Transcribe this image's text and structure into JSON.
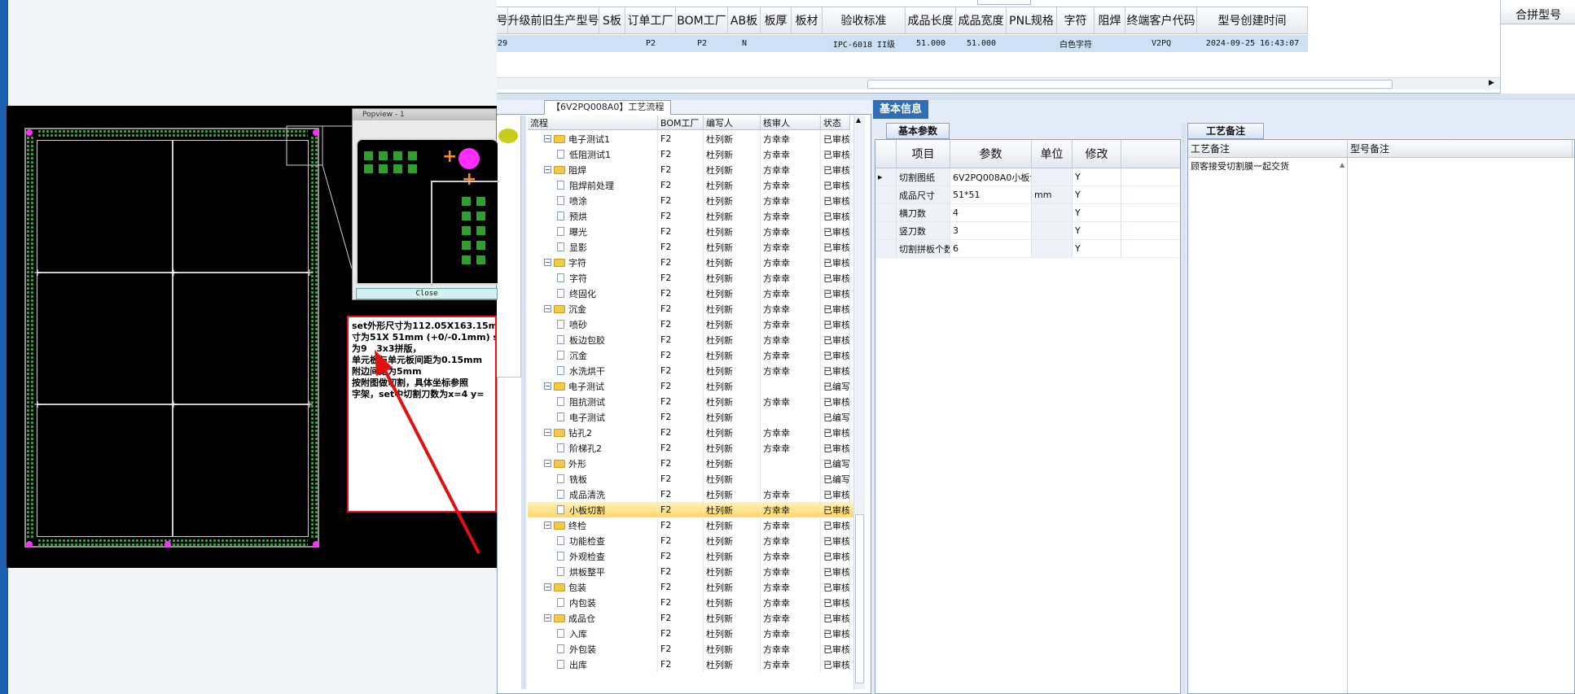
{
  "top_grid": {
    "columns": [
      "号",
      "升级前旧生产型号",
      "S板",
      "订单工厂",
      "BOM工厂",
      "AB板",
      "板厚",
      "板材",
      "验收标准",
      "成品长度",
      "成品宽度",
      "PNL规格",
      "字符",
      "阻焊",
      "终端客户代码",
      "型号创建时间"
    ],
    "row": [
      "29",
      "",
      "",
      "P2",
      "P2",
      "N",
      "",
      "",
      "IPC-6018 II级",
      "51.000",
      "51.000",
      "",
      "白色字符",
      "",
      "V2PQ",
      "2024-09-25 16:43:07"
    ],
    "right_column": "合拼型号"
  },
  "cad": {
    "popview_title": "Popview - 1",
    "popview_close": "Close",
    "note_text": "set外形尺寸为112.05X163.15m\n寸为51X 51mm (+0/-0.1mm) set\n为9   3x3拼版，\n单元板与单元板间距为0.15mm\n附边间距为5mm\n按附图做切割，具体坐标参照\n字架，set中切割刀数为x=4 y="
  },
  "flow": {
    "tab_title": "【6V2PQ008A0】工艺流程",
    "headers": [
      "流程",
      "BOM工厂",
      "编写人",
      "核审人",
      "状态"
    ],
    "rows": [
      {
        "level": 1,
        "name": "电子测试1",
        "bom": "F2",
        "writer": "杜列新",
        "reviewer": "方幸幸",
        "status": "已审核",
        "folder": true
      },
      {
        "level": 2,
        "name": "低阻测试1",
        "bom": "F2",
        "writer": "杜列新",
        "reviewer": "方幸幸",
        "status": "已审核",
        "folder": false
      },
      {
        "level": 1,
        "name": "阻焊",
        "bom": "F2",
        "writer": "杜列新",
        "reviewer": "方幸幸",
        "status": "已审核",
        "folder": true
      },
      {
        "level": 2,
        "name": "阻焊前处理",
        "bom": "F2",
        "writer": "杜列新",
        "reviewer": "方幸幸",
        "status": "已审核",
        "folder": false
      },
      {
        "level": 2,
        "name": "喷涂",
        "bom": "F2",
        "writer": "杜列新",
        "reviewer": "方幸幸",
        "status": "已审核",
        "folder": false
      },
      {
        "level": 2,
        "name": "预烘",
        "bom": "F2",
        "writer": "杜列新",
        "reviewer": "方幸幸",
        "status": "已审核",
        "folder": false
      },
      {
        "level": 2,
        "name": "曝光",
        "bom": "F2",
        "writer": "杜列新",
        "reviewer": "方幸幸",
        "status": "已审核",
        "folder": false
      },
      {
        "level": 2,
        "name": "显影",
        "bom": "F2",
        "writer": "杜列新",
        "reviewer": "方幸幸",
        "status": "已审核",
        "folder": false
      },
      {
        "level": 1,
        "name": "字符",
        "bom": "F2",
        "writer": "杜列新",
        "reviewer": "方幸幸",
        "status": "已审核",
        "folder": true
      },
      {
        "level": 2,
        "name": "字符",
        "bom": "F2",
        "writer": "杜列新",
        "reviewer": "方幸幸",
        "status": "已审核",
        "folder": false
      },
      {
        "level": 2,
        "name": "终固化",
        "bom": "F2",
        "writer": "杜列新",
        "reviewer": "方幸幸",
        "status": "已审核",
        "folder": false
      },
      {
        "level": 1,
        "name": "沉金",
        "bom": "F2",
        "writer": "杜列新",
        "reviewer": "方幸幸",
        "status": "已审核",
        "folder": true
      },
      {
        "level": 2,
        "name": "喷砂",
        "bom": "F2",
        "writer": "杜列新",
        "reviewer": "方幸幸",
        "status": "已审核",
        "folder": false
      },
      {
        "level": 2,
        "name": "板边包胶",
        "bom": "F2",
        "writer": "杜列新",
        "reviewer": "方幸幸",
        "status": "已审核",
        "folder": false
      },
      {
        "level": 2,
        "name": "沉金",
        "bom": "F2",
        "writer": "杜列新",
        "reviewer": "方幸幸",
        "status": "已审核",
        "folder": false
      },
      {
        "level": 2,
        "name": "水洗烘干",
        "bom": "F2",
        "writer": "杜列新",
        "reviewer": "方幸幸",
        "status": "已审核",
        "folder": false
      },
      {
        "level": 1,
        "name": "电子测试",
        "bom": "F2",
        "writer": "杜列新",
        "reviewer": "",
        "status": "已编写",
        "folder": true
      },
      {
        "level": 2,
        "name": "阻抗测试",
        "bom": "F2",
        "writer": "杜列新",
        "reviewer": "方幸幸",
        "status": "已审核",
        "folder": false
      },
      {
        "level": 2,
        "name": "电子测试",
        "bom": "F2",
        "writer": "杜列新",
        "reviewer": "",
        "status": "已编写",
        "folder": false
      },
      {
        "level": 1,
        "name": "钻孔2",
        "bom": "F2",
        "writer": "杜列新",
        "reviewer": "方幸幸",
        "status": "已审核",
        "folder": true
      },
      {
        "level": 2,
        "name": "阶梯孔2",
        "bom": "F2",
        "writer": "杜列新",
        "reviewer": "方幸幸",
        "status": "已审核",
        "folder": false
      },
      {
        "level": 1,
        "name": "外形",
        "bom": "F2",
        "writer": "杜列新",
        "reviewer": "",
        "status": "已编写",
        "folder": true
      },
      {
        "level": 2,
        "name": "铣板",
        "bom": "F2",
        "writer": "杜列新",
        "reviewer": "",
        "status": "已编写",
        "folder": false
      },
      {
        "level": 2,
        "name": "成品清洗",
        "bom": "F2",
        "writer": "杜列新",
        "reviewer": "方幸幸",
        "status": "已审核",
        "folder": false
      },
      {
        "level": 2,
        "name": "小板切割",
        "bom": "F2",
        "writer": "杜列新",
        "reviewer": "方幸幸",
        "status": "已审核",
        "folder": false,
        "selected": true
      },
      {
        "level": 1,
        "name": "终检",
        "bom": "F2",
        "writer": "杜列新",
        "reviewer": "方幸幸",
        "status": "已审核",
        "folder": true
      },
      {
        "level": 2,
        "name": "功能检查",
        "bom": "F2",
        "writer": "杜列新",
        "reviewer": "方幸幸",
        "status": "已审核",
        "folder": false
      },
      {
        "level": 2,
        "name": "外观检查",
        "bom": "F2",
        "writer": "杜列新",
        "reviewer": "方幸幸",
        "status": "已审核",
        "folder": false
      },
      {
        "level": 2,
        "name": "烘板整平",
        "bom": "F2",
        "writer": "杜列新",
        "reviewer": "方幸幸",
        "status": "已审核",
        "folder": false
      },
      {
        "level": 1,
        "name": "包装",
        "bom": "F2",
        "writer": "杜列新",
        "reviewer": "方幸幸",
        "status": "已审核",
        "folder": true
      },
      {
        "level": 2,
        "name": "内包装",
        "bom": "F2",
        "writer": "杜列新",
        "reviewer": "方幸幸",
        "status": "已审核",
        "folder": false
      },
      {
        "level": 1,
        "name": "成品仓",
        "bom": "F2",
        "writer": "杜列新",
        "reviewer": "方幸幸",
        "status": "已审核",
        "folder": true
      },
      {
        "level": 2,
        "name": "入库",
        "bom": "F2",
        "writer": "杜列新",
        "reviewer": "方幸幸",
        "status": "已审核",
        "folder": false
      },
      {
        "level": 2,
        "name": "外包装",
        "bom": "F2",
        "writer": "杜列新",
        "reviewer": "方幸幸",
        "status": "已审核",
        "folder": false
      },
      {
        "level": 2,
        "name": "出库",
        "bom": "F2",
        "writer": "杜列新",
        "reviewer": "方幸幸",
        "status": "已审核",
        "folder": false
      }
    ]
  },
  "basic_info": {
    "tab": "基本信息",
    "params_tab": "基本参数",
    "notes_tab": "工艺备注",
    "param_headers": [
      "项目",
      "参数",
      "单位",
      "修改"
    ],
    "params": [
      {
        "item": "切割图纸",
        "value": "6V2PQ008A0小板切...",
        "unit": "",
        "edit": "Y",
        "current": true
      },
      {
        "item": "成品尺寸",
        "value": "51*51",
        "unit": "mm",
        "edit": "Y"
      },
      {
        "item": "横刀数",
        "value": "4",
        "unit": "",
        "edit": "Y"
      },
      {
        "item": "竖刀数",
        "value": "3",
        "unit": "",
        "edit": "Y"
      },
      {
        "item": "切割拼板个数",
        "value": "6",
        "unit": "",
        "edit": "Y"
      }
    ],
    "note_headers": [
      "工艺备注",
      "型号备注"
    ],
    "process_note": "顾客接受切割膜一起交货"
  },
  "colors": {
    "accent": "#2f6db8",
    "selected_row": "#ffd66a",
    "grid_selected": "#cce0f6",
    "pcb_green": "#39a839",
    "pcb_pad": "#ff2cff",
    "annot_red": "#e11111"
  }
}
